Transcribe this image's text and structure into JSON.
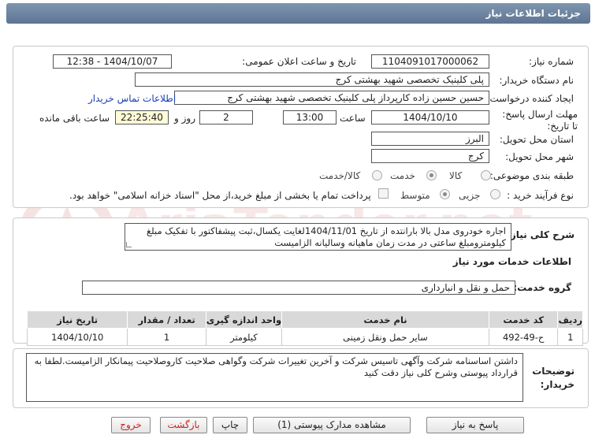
{
  "header": {
    "title": "جزئیات اطلاعات نیاز"
  },
  "info": {
    "need_number_label": "شماره نیاز:",
    "need_number": "1104091017000062",
    "announce_label": "تاریخ و ساعت اعلان عمومی:",
    "announce_value": "1404/10/07 - 12:38",
    "buyer_org_label": "نام دستگاه خریدار:",
    "buyer_org": "پلی کلینیک تخصصی شهید بهشتی کرج",
    "creator_label": "ایجاد کننده درخواست:",
    "creator": "حسین حسین زاده کارپرداز پلی کلینیک تخصصی شهید بهشتی کرج",
    "contact_link": "اطلاعات تماس خریدار",
    "deadline_label": "مهلت ارسال پاسخ: تا تاریخ:",
    "deadline_date": "1404/10/10",
    "time_label": "ساعت",
    "deadline_time": "13:00",
    "days_value": "2",
    "days_label": "روز و",
    "remaining_time": "22:25:40",
    "remaining_label": "ساعت باقی مانده",
    "province_label": "استان محل تحویل:",
    "province": "البرز",
    "city_label": "شهر محل تحویل:",
    "city": "کرج",
    "category_label": "طبقه بندی موضوعی:",
    "category_options": [
      "کالا",
      "خدمت",
      "کالا/خدمت"
    ],
    "category_selected": "خدمت",
    "process_label": "نوع فرآیند خرید :",
    "process_options": [
      "جزیی",
      "متوسط"
    ],
    "process_selected": "متوسط",
    "payment_note": "پرداخت تمام یا بخشی از مبلغ خرید،از محل \"اسناد خزانه اسلامی\" خواهد بود."
  },
  "description": {
    "label": "شرح کلی نیاز:",
    "text": "اجاره خودروی مدل بالا بارانتده از تاریخ 1404/11/01لغایت یکسال،ثبت پیشفاکتور با تفکیک مبلغ کیلومترومبلغ ساعتی در مدت زمان ماهیانه وسالیانه الزامیست"
  },
  "services": {
    "section_title": "اطلاعات خدمات مورد نیاز",
    "group_label": "گروه خدمت:",
    "group_value": "حمل و نقل و انبارداری",
    "columns": [
      "ردیف",
      "کد خدمت",
      "نام خدمت",
      "واحد اندازه گیری",
      "تعداد / مقدار",
      "تاریخ نیاز"
    ],
    "rows": [
      {
        "row": "1",
        "code": "ح-49-492",
        "name": "سایر حمل ونقل زمینی",
        "unit": "کیلومتر",
        "qty": "1",
        "date": "1404/10/10"
      }
    ]
  },
  "buyer_notes": {
    "label": "توضیحات خریدار:",
    "text": "داشتن اساسنامه شرکت وآگهی تاسیس شرکت و آخرین تغییرات شرکت وگواهی صلاحیت کاروصلاحیت پیمانکار الزامیست.لطفا به قرارداد پیوستی وشرح کلی نیاز دقت کنید"
  },
  "buttons": {
    "reply": "پاسخ به نیاز",
    "attachments": "مشاهده مدارک پیوستی (1)",
    "print": "چاپ",
    "back": "بازگشت",
    "exit": "خروج"
  },
  "watermark_text": "AriaTender.net",
  "colors": {
    "header": "#6e84a0",
    "link": "#1a3fb5",
    "red_button_text": "#cc2222"
  }
}
